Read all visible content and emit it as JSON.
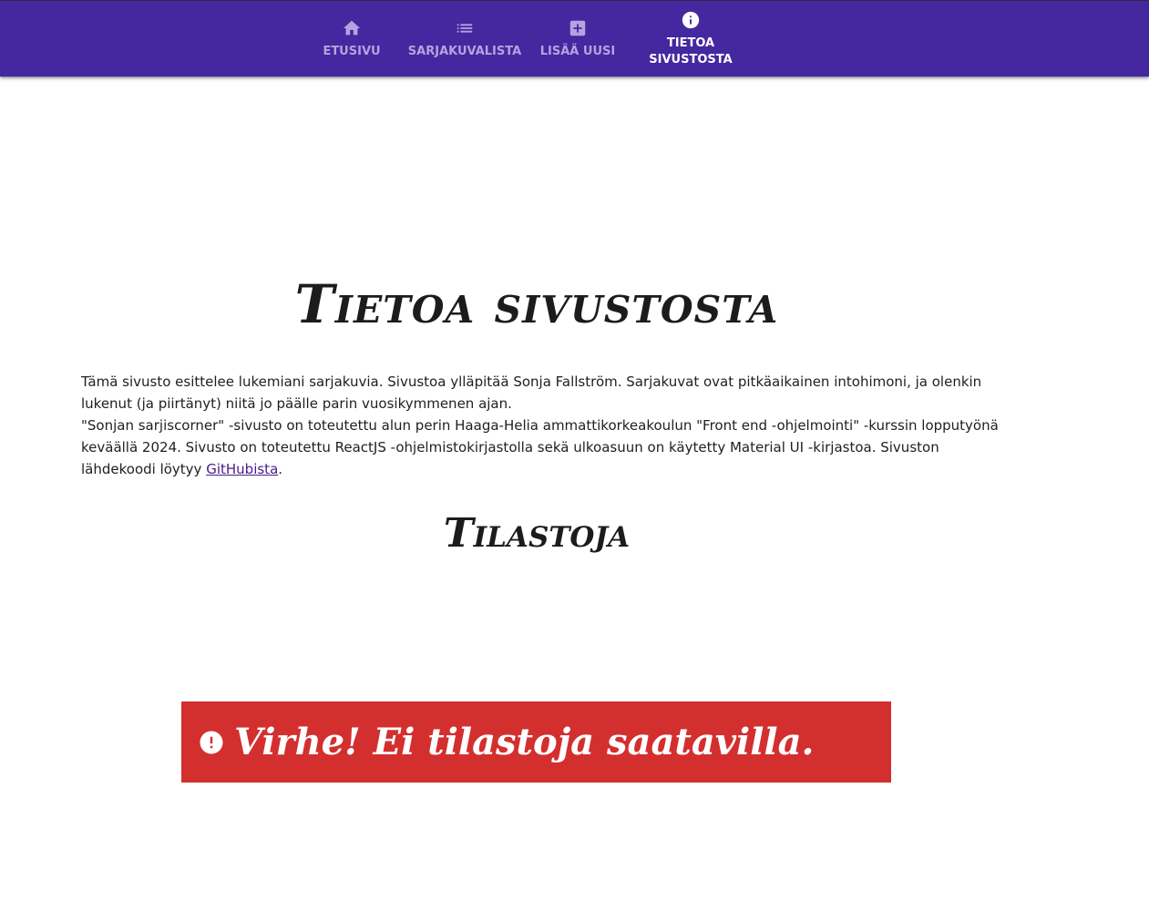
{
  "nav": {
    "tabs": [
      {
        "label": "ETUSIVU",
        "icon": "home-icon"
      },
      {
        "label": "SARJAKUVALISTA",
        "icon": "list-icon"
      },
      {
        "label": "LISÄÄ UUSI",
        "icon": "add-box-icon"
      },
      {
        "label": "TIETOA SIVUSTOSTA",
        "icon": "info-icon",
        "active": true
      }
    ]
  },
  "page": {
    "title": "Tietoa sivustosta",
    "intro": {
      "line1": "Tämä sivusto esittelee lukemiani sarjakuvia. Sivustoa ylläpitää Sonja Fallström. Sarjakuvat ovat pitkäaikainen intohimoni, ja olenkin lukenut (ja piirtänyt) niitä jo päälle parin vuosikymmenen ajan.",
      "line2_pre": "\"Sonjan sarjiscorner\" -sivusto on toteutettu alun perin Haaga-Helia ammattikorkeakoulun \"Front end -ohjelmointi\" -kurssin lopputyönä keväällä 2024. Sivusto on toteutettu ReactJS -ohjelmistokirjastolla sekä ulkoasuun on käytetty Material UI -kirjastoa. Sivuston lähdekoodi löytyy ",
      "link_text": "GitHubista",
      "line2_post": "."
    },
    "stats_title": "Tilastoja",
    "error": {
      "icon": "error-icon",
      "text": "Virhe! Ei tilastoja saatavilla."
    }
  },
  "colors": {
    "appbar": "#4527a0",
    "error": "#d32f2f",
    "link": "#4a1a8a"
  }
}
